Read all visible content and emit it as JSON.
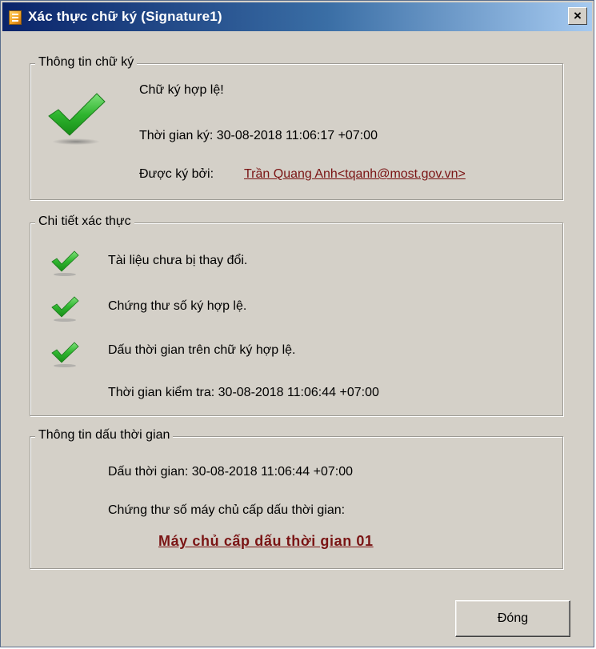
{
  "window": {
    "title": "Xác thực chữ ký (Signature1)",
    "close_glyph": "×"
  },
  "signature_info": {
    "legend": "Thông tin chữ ký",
    "status": "Chữ ký hợp lệ!",
    "sign_time": "Thời gian ký: 30-08-2018 11:06:17 +07:00",
    "signed_by_label": "Được ký bởi:",
    "signer": "Trần Quang Anh<tqanh@most.gov.vn>"
  },
  "verification_details": {
    "legend": "Chi tiết xác thực",
    "items": [
      "Tài liệu chưa bị thay đổi.",
      "Chứng thư số ký hợp lệ.",
      "Dấu thời gian trên chữ ký hợp lệ."
    ],
    "check_time": "Thời gian kiểm tra: 30-08-2018 11:06:44 +07:00"
  },
  "timestamp_info": {
    "legend": "Thông tin dấu thời gian",
    "timestamp": "Dấu thời gian: 30-08-2018 11:06:44 +07:00",
    "tsa_cert_label": "Chứng thư số máy chủ cấp dấu thời gian:",
    "tsa_name": "Máy chủ cấp dấu thời gian 01"
  },
  "buttons": {
    "close_label": "Đóng"
  },
  "icons": {
    "app": "document-signature-icon",
    "check": "checkmark-icon"
  },
  "colors": {
    "check_green": "#3cb83c",
    "link_red": "#7a1414",
    "title_blue": "#0a246a"
  }
}
